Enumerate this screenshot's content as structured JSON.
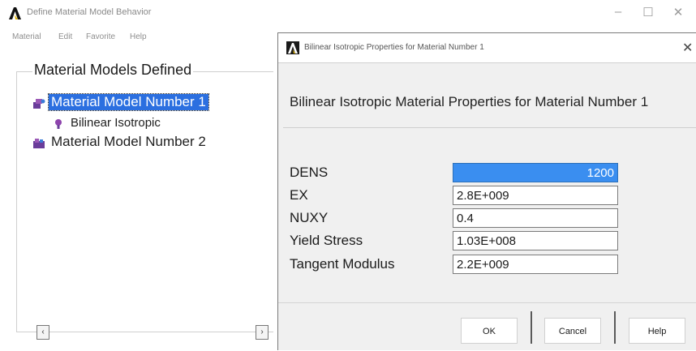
{
  "window": {
    "title": "Define Material Model Behavior",
    "controls": {
      "minimize": "–",
      "maximize": "☐",
      "close": "✕"
    }
  },
  "menu": [
    "Material",
    "Edit",
    "Favorite",
    "Help"
  ],
  "models_panel": {
    "title": "Material Models Defined",
    "items": [
      {
        "label": "Material Model Number 1",
        "selected": true,
        "icon": "material-model-icon"
      },
      {
        "label": "Bilinear Isotropic",
        "selected": false,
        "icon": "property-icon"
      },
      {
        "label": "Material Model Number 2",
        "selected": false,
        "icon": "material-model-icon"
      }
    ]
  },
  "dialog": {
    "title": "Bilinear Isotropic Properties for Material Number 1",
    "close": "✕",
    "heading": "Bilinear Isotropic Material Properties for Material Number 1",
    "properties": [
      {
        "label": "DENS",
        "value": "1200"
      },
      {
        "label": "EX",
        "value": "2.8E+009"
      },
      {
        "label": "NUXY",
        "value": "0.4"
      },
      {
        "label": "Yield Stress",
        "value": "1.03E+008"
      },
      {
        "label": "Tangent Modulus",
        "value": "2.2E+009"
      }
    ],
    "buttons": {
      "ok": "OK",
      "cancel": "Cancel",
      "help": "Help"
    }
  }
}
